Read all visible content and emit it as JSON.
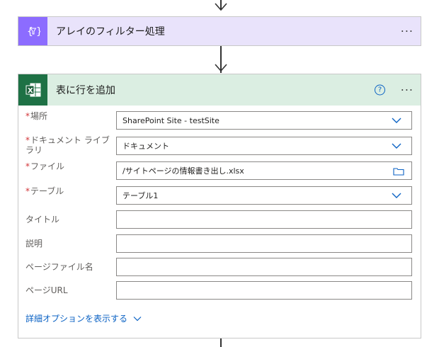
{
  "filter_action": {
    "title": "アレイのフィルター処理",
    "icon": "filter-braces-icon",
    "more_label": "···",
    "color": "#8c6cff"
  },
  "excel_action": {
    "title": "表に行を追加",
    "icon": "excel-icon",
    "help_label": "?",
    "more_label": "···",
    "color": "#1e7145"
  },
  "fields": [
    {
      "label": "場所",
      "required": "*",
      "value": "SharePoint Site - testSite",
      "control": "dropdown"
    },
    {
      "label": "ドキュメント ライブラリ",
      "required": "*",
      "value": "ドキュメント",
      "control": "dropdown"
    },
    {
      "label": "ファイル",
      "required": "*",
      "value": "/サイトページの情報書き出し.xlsx",
      "control": "file-picker"
    },
    {
      "label": "テーブル",
      "required": "*",
      "value": "テーブル1",
      "control": "dropdown"
    },
    {
      "label": "タイトル",
      "required": "",
      "value": "",
      "control": "text"
    },
    {
      "label": "説明",
      "required": "",
      "value": "",
      "control": "text"
    },
    {
      "label": "ページファイル名",
      "required": "",
      "value": "",
      "control": "text"
    },
    {
      "label": "ページURL",
      "required": "",
      "value": "",
      "control": "text"
    }
  ],
  "advanced_options_label": "詳細オプションを表示する",
  "colors": {
    "accent": "#0b62c4",
    "required": "#d13438",
    "filter_header": "#e9e3fb",
    "excel_header": "#dbeee2"
  }
}
